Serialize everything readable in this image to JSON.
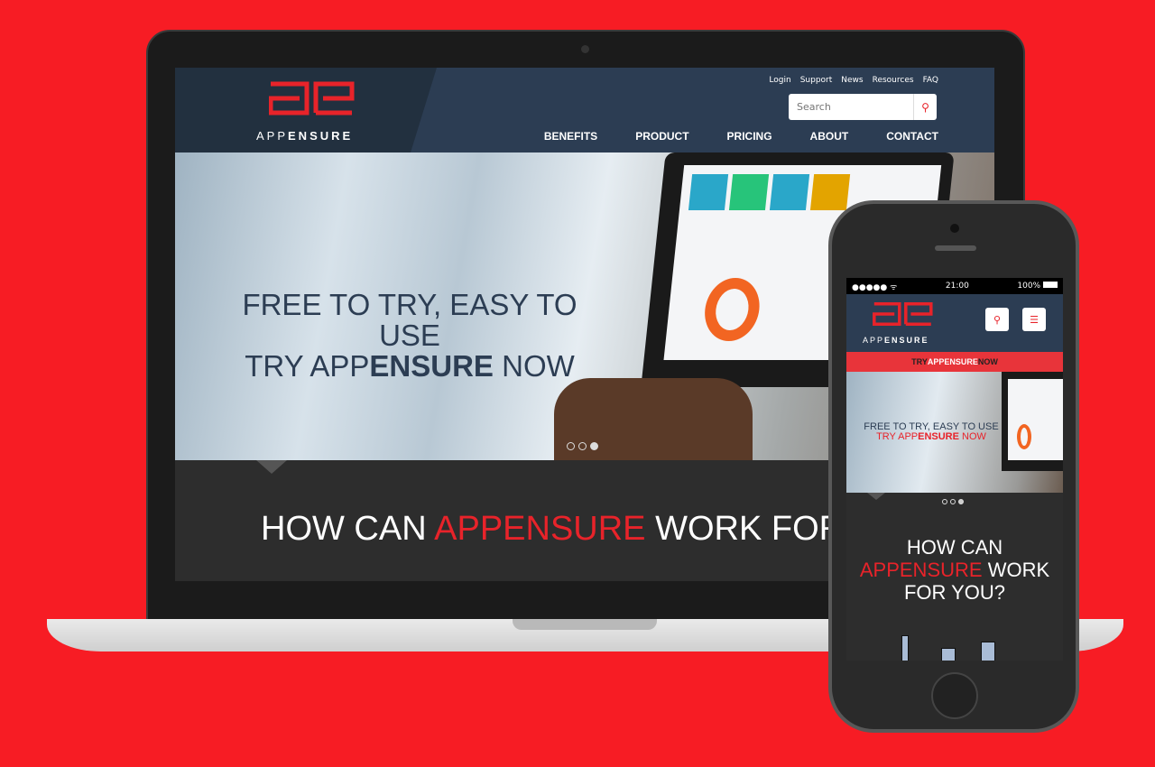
{
  "colors": {
    "background": "#f71c24",
    "brand_red": "#e8232a",
    "header_navy": "#2c3d53",
    "section_dark": "#2d2d2d"
  },
  "brand": {
    "logo_mark": "ae",
    "name_light": "APP",
    "name_bold": "ENSURE"
  },
  "desktop": {
    "top_links": [
      "Login",
      "Support",
      "News",
      "Resources",
      "FAQ"
    ],
    "search": {
      "placeholder": "Search",
      "icon": "search-icon"
    },
    "nav": [
      "BENEFITS",
      "PRODUCT",
      "PRICING",
      "ABOUT",
      "CONTACT"
    ],
    "hero": {
      "line1": "FREE TO TRY, EASY TO USE",
      "line2_a": "TRY APP",
      "line2_b": "ENSURE",
      "line2_c": " NOW",
      "slide_count": 3,
      "active_slide": 3
    },
    "section": {
      "a": "HOW CAN ",
      "b": "APPENSURE",
      "c": " WORK FOR YOU?"
    }
  },
  "mobile": {
    "status": {
      "signal": "●●●●● ᯤ",
      "time": "21:00",
      "battery": "100%"
    },
    "banner": {
      "a": "TRY",
      "b": "APPENSURE",
      "c": "NOW"
    },
    "hero": {
      "line1": "FREE TO TRY, EASY TO USE",
      "line2_a": "TRY APP",
      "line2_b": "ENSURE",
      "line2_c": " NOW"
    },
    "section": {
      "l1": "HOW CAN",
      "l2a": "APPENSURE",
      "l2b": " WORK",
      "l3": "FOR YOU?"
    },
    "icons": [
      "search-icon",
      "menu-icon"
    ]
  }
}
